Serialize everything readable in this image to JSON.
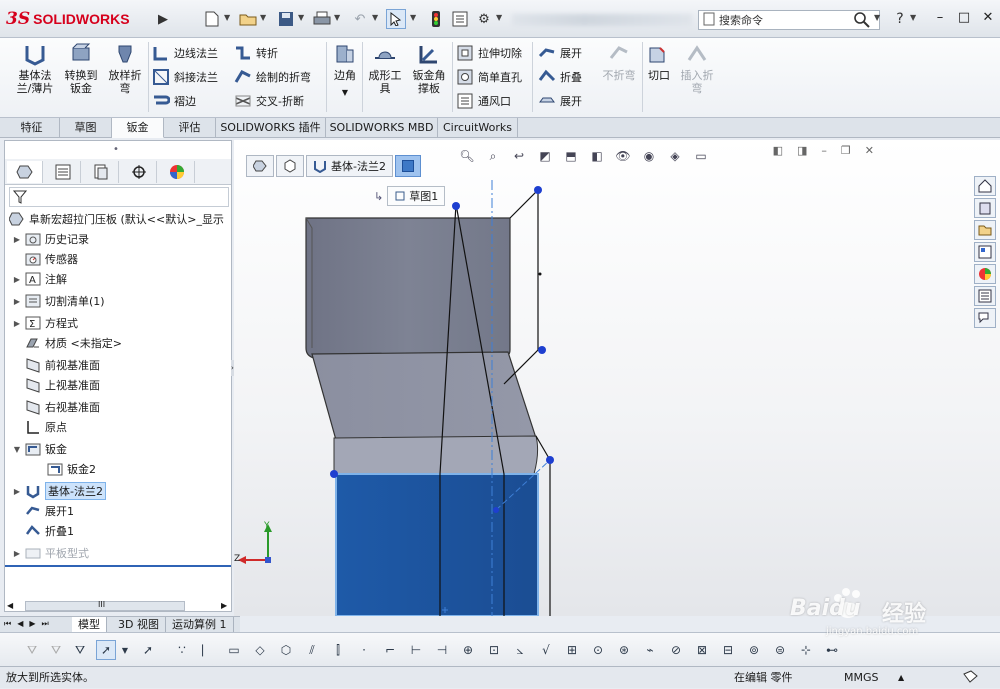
{
  "app": {
    "brand_mark": "3S",
    "brand_name": "SOLIDWORKS"
  },
  "titlebar": {
    "search_placeholder": "搜索命令",
    "help_label": "?",
    "icons": [
      "new-file-icon",
      "open-icon",
      "save-icon",
      "print-icon",
      "undo-icon",
      "select-icon",
      "traffic-light-icon",
      "file-properties-icon",
      "options-gear-icon",
      "search-icon"
    ]
  },
  "ribbon": {
    "big_buttons": [
      {
        "label": "基体法\n兰/薄片"
      },
      {
        "label": "转换到\n钣金"
      },
      {
        "label": "放样折\n弯"
      }
    ],
    "group2": [
      {
        "label": "边线法兰"
      },
      {
        "label": "斜接法兰"
      },
      {
        "label": "褶边"
      }
    ],
    "group3": [
      {
        "label": "转折"
      },
      {
        "label": "绘制的折弯"
      },
      {
        "label": "交叉-折断"
      }
    ],
    "corner": {
      "label": "边角"
    },
    "forming": {
      "label": "成形工\n具"
    },
    "gusset": {
      "label": "钣金角\n撑板"
    },
    "group4": [
      {
        "label": "拉伸切除"
      },
      {
        "label": "简单直孔"
      },
      {
        "label": "通风口"
      }
    ],
    "group5": [
      {
        "label": "展开"
      },
      {
        "label": "折叠"
      },
      {
        "label": "展开"
      }
    ],
    "no_bend": {
      "label": "不折弯"
    },
    "rip": {
      "label": "切口"
    },
    "insert_bends": {
      "label": "插入折\n弯"
    }
  },
  "tabs": [
    "特征",
    "草图",
    "钣金",
    "评估",
    "SOLIDWORKS 插件",
    "SOLIDWORKS MBD",
    "CircuitWorks"
  ],
  "active_tab": "钣金",
  "tree": {
    "root": "阜新宏超拉门压板 (默认<<默认>_显示",
    "items": [
      {
        "label": "历史记录",
        "expand": "▶"
      },
      {
        "label": "传感器",
        "expand": ""
      },
      {
        "label": "注解",
        "expand": "▶"
      },
      {
        "label": "切割清单(1)",
        "expand": "▶"
      },
      {
        "label": "方程式",
        "expand": "▶"
      },
      {
        "label": "材质 <未指定>",
        "expand": ""
      },
      {
        "label": "前视基准面",
        "expand": ""
      },
      {
        "label": "上视基准面",
        "expand": ""
      },
      {
        "label": "右视基准面",
        "expand": ""
      },
      {
        "label": "原点",
        "expand": ""
      },
      {
        "label": "钣金",
        "expand": "▼"
      },
      {
        "label": "钣金2",
        "expand": ""
      },
      {
        "label": "基体-法兰2",
        "expand": "▶"
      },
      {
        "label": "展开1",
        "expand": ""
      },
      {
        "label": "折叠1",
        "expand": ""
      },
      {
        "label": "平板型式",
        "expand": "▶"
      }
    ],
    "scroll_thumb": "III"
  },
  "viewport": {
    "breadcrumb": "基体-法兰2",
    "sketch_chip": "草图1",
    "triad": {
      "y": "Y",
      "z": "Z"
    }
  },
  "model_tabs": [
    "模型",
    "3D 视图",
    "运动算例 1"
  ],
  "active_model_tab": "模型",
  "status": {
    "message": "放大到所选实体。",
    "mode": "在编辑 零件",
    "units": "MMGS"
  },
  "watermark": {
    "brand": "Baidu",
    "site": "经验",
    "url": "jingyan.baidu.com"
  },
  "colors": {
    "brand_red": "#d6001c",
    "selected_face": "#1d4f9a",
    "part_gray": "#7e8394"
  }
}
